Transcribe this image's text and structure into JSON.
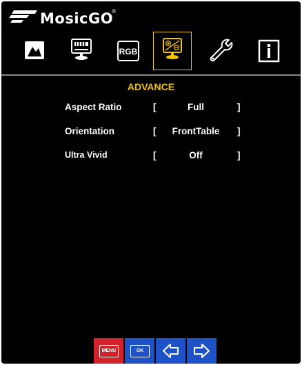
{
  "brand": {
    "name": "MosicGO",
    "registered": "®"
  },
  "tabs": [
    {
      "icon": "picture-icon",
      "label": "Picture"
    },
    {
      "icon": "display-icon",
      "label": "Display"
    },
    {
      "icon": "rgb-icon",
      "label": "RGB"
    },
    {
      "icon": "advance-icon",
      "label": "Advance",
      "active": true
    },
    {
      "icon": "wrench-icon",
      "label": "Setup"
    },
    {
      "icon": "info-icon",
      "label": "Information"
    }
  ],
  "section": {
    "title": "ADVANCE"
  },
  "settings": [
    {
      "label": "Aspect Ratio",
      "open": "[",
      "value": "Full",
      "close": "]"
    },
    {
      "label": "Orientation",
      "open": "[",
      "value": "FrontTable",
      "close": "]"
    },
    {
      "label": "Ultra Vivid",
      "open": "[",
      "value": "Off",
      "close": "]"
    }
  ],
  "buttons": {
    "menu": "MENU",
    "ok": "OK"
  },
  "colors": {
    "accent": "#f3c400",
    "menu_button": "#d2232a",
    "nav_button": "#1d52c8",
    "background": "#000000"
  }
}
